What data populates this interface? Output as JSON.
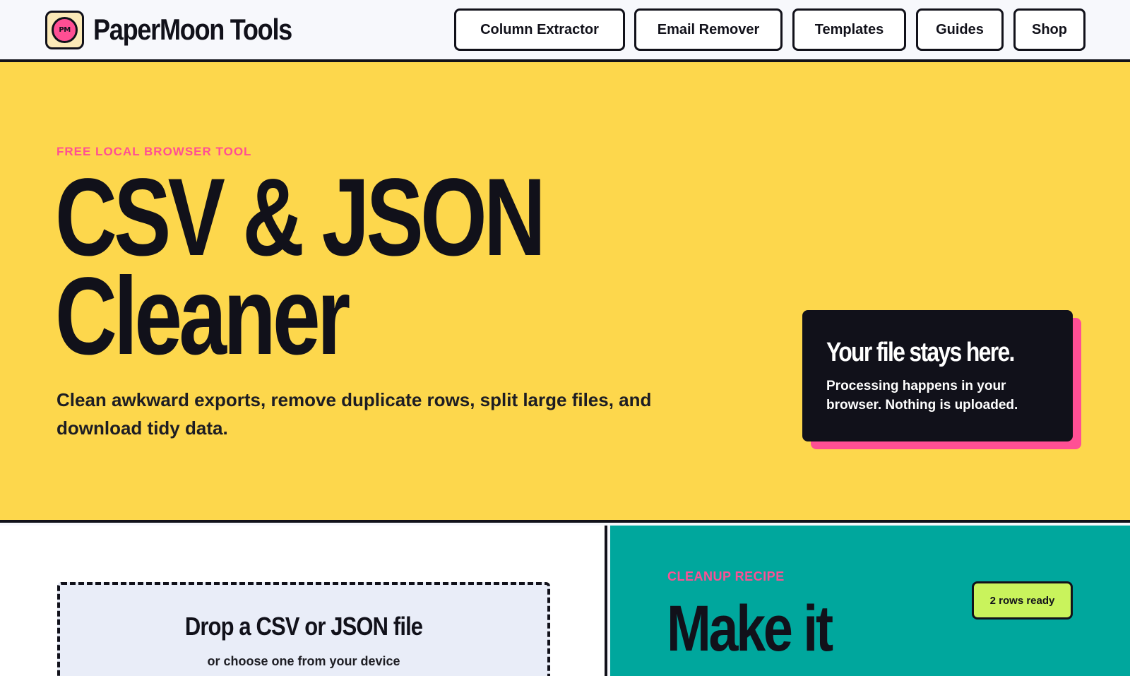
{
  "header": {
    "logo_text": "PM",
    "brand": "PaperMoon Tools",
    "nav": [
      "Column Extractor",
      "Email Remover",
      "Templates",
      "Guides",
      "Shop"
    ]
  },
  "hero": {
    "eyebrow": "FREE LOCAL BROWSER TOOL",
    "title_line1": "CSV & JSON",
    "title_line2": "Cleaner",
    "subtitle": "Clean awkward exports, remove duplicate rows, split large files, and download tidy data.",
    "privacy_card": {
      "title": "Your file stays here.",
      "body": "Processing happens in your browser. Nothing is uploaded."
    }
  },
  "upload": {
    "title": "Drop a CSV or JSON file",
    "subtitle": "or choose one from your device"
  },
  "recipe": {
    "eyebrow": "CLEANUP RECIPE",
    "title": "Make it",
    "badge": "2 rows ready"
  },
  "colors": {
    "hero_bg": "#fdd74c",
    "accent_pink": "#ff4f94",
    "teal": "#00a79d",
    "dark": "#11111a",
    "badge_green": "#c9f35c"
  }
}
